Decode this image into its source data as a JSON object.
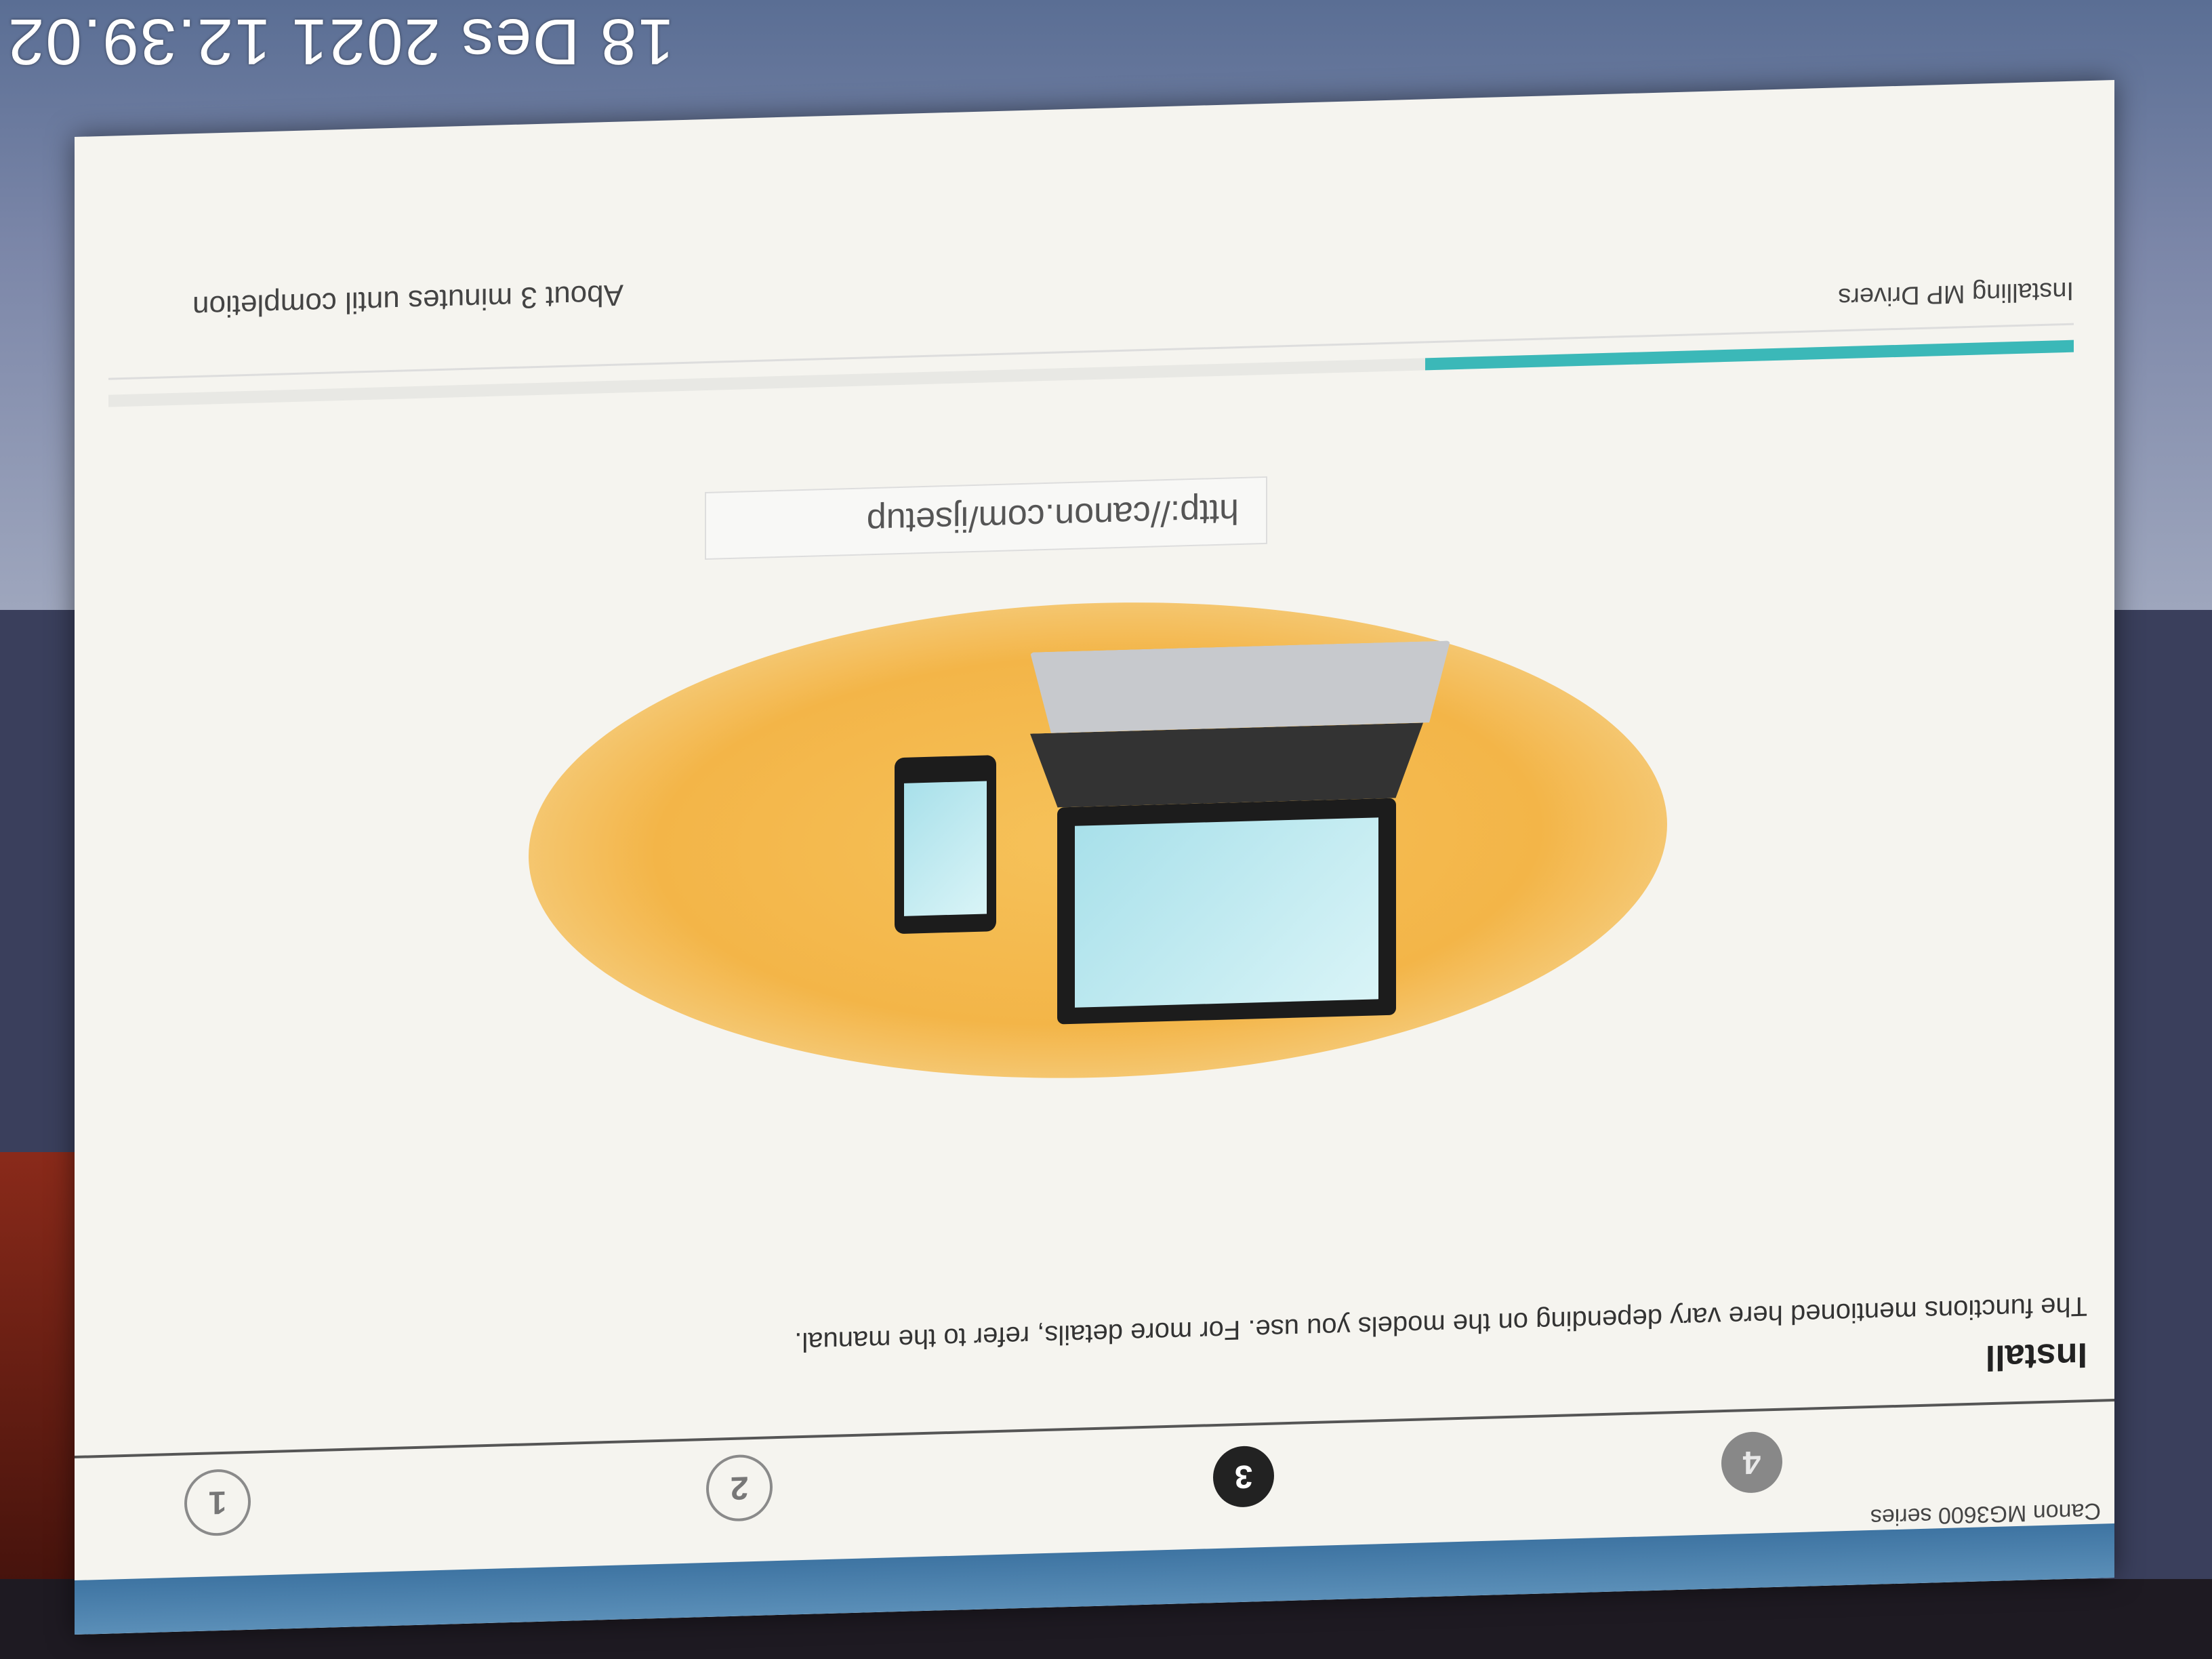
{
  "photo": {
    "timestamp": "18 Des 2021 12.39.02"
  },
  "window": {
    "title": "Canon MG3600 series"
  },
  "steps": [
    {
      "label": "1",
      "state": "done"
    },
    {
      "label": "2",
      "state": "done"
    },
    {
      "label": "3",
      "state": "current"
    },
    {
      "label": "4",
      "state": "todo"
    }
  ],
  "install": {
    "heading": "Install",
    "description": "The functions mentioned here vary depending on the models you use. For more details, refer to the manual."
  },
  "url": "http://canon.com/ijsetup",
  "progress": {
    "status": "Installing MP Drivers",
    "eta": "About 3 minutes until completion",
    "fraction": 0.33,
    "color": "#3bb8b8"
  }
}
